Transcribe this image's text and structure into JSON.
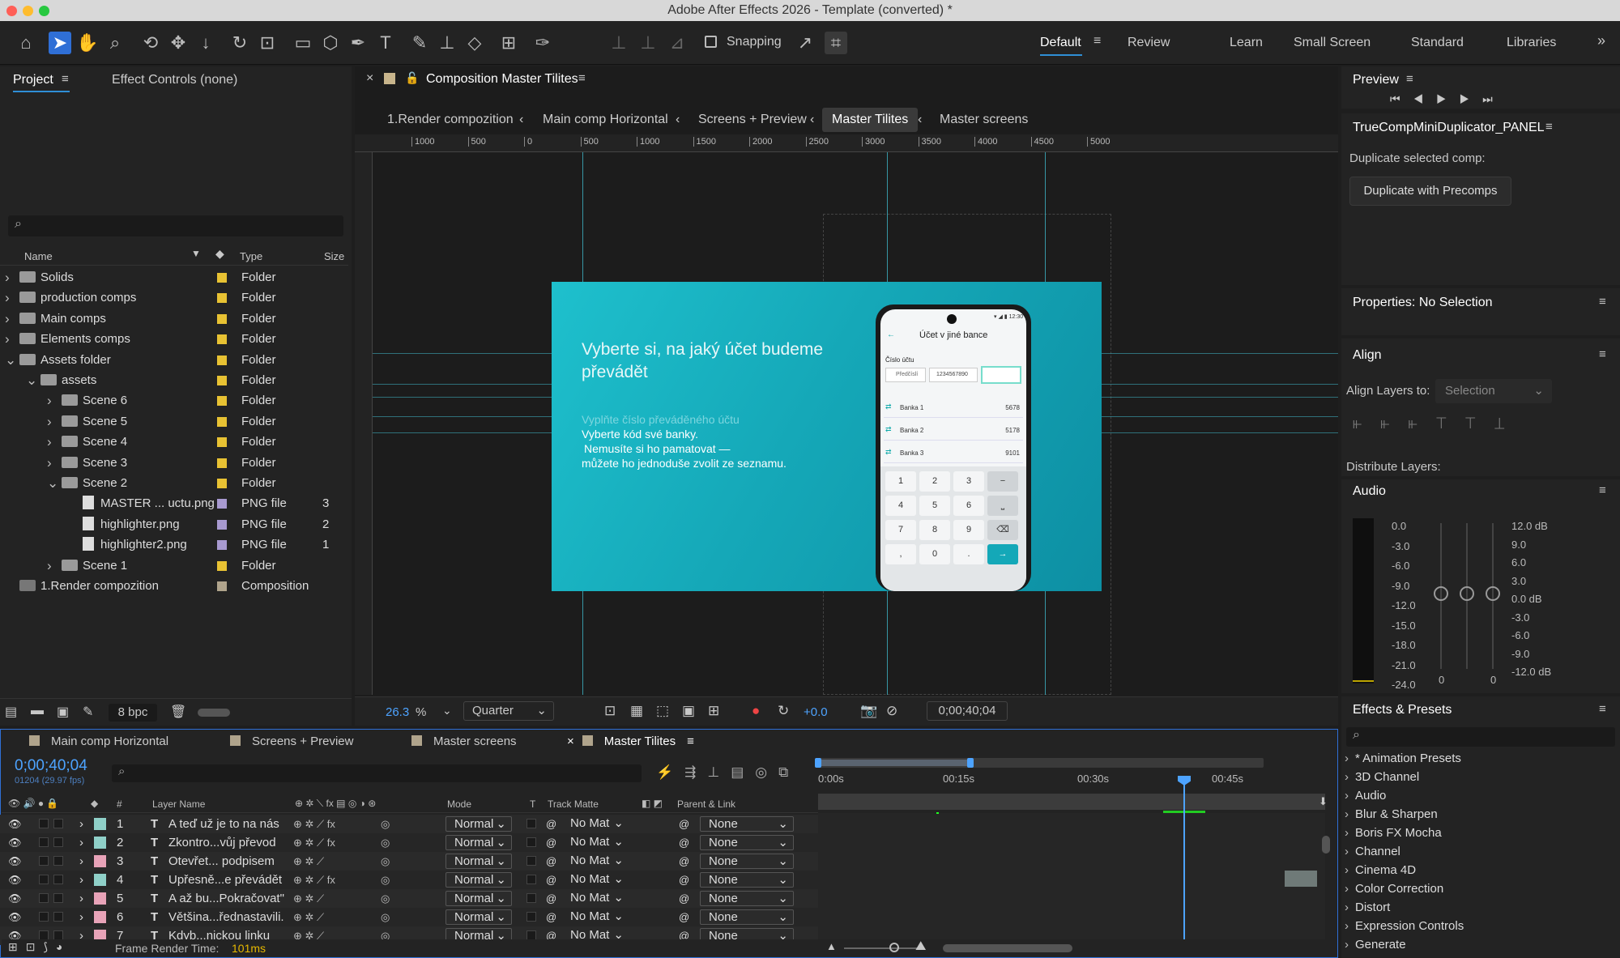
{
  "window": {
    "title": "Adobe After Effects 2026 - Template (converted) *"
  },
  "toolbar": {
    "snapping": "Snapping",
    "workspaces": [
      "Default",
      "Review",
      "Learn",
      "Small Screen",
      "Standard",
      "Libraries"
    ]
  },
  "project": {
    "tab": "Project",
    "effect_controls": "Effect Controls (none)",
    "columns": {
      "name": "Name",
      "type": "Type",
      "size": "Size"
    },
    "items": [
      {
        "name": "Solids",
        "type": "Folder",
        "size": "",
        "color": "#e8c233"
      },
      {
        "name": "production comps",
        "type": "Folder",
        "size": "",
        "color": "#e8c233"
      },
      {
        "name": "Main comps",
        "type": "Folder",
        "size": "",
        "color": "#e8c233"
      },
      {
        "name": "Elements comps",
        "type": "Folder",
        "size": "",
        "color": "#e8c233"
      },
      {
        "name": "Assets folder",
        "type": "Folder",
        "size": "",
        "color": "#e8c233"
      },
      {
        "name": "assets",
        "type": "Folder",
        "size": "",
        "color": "#e8c233"
      },
      {
        "name": "Scene 6",
        "type": "Folder",
        "size": "",
        "color": "#e8c233"
      },
      {
        "name": "Scene 5",
        "type": "Folder",
        "size": "",
        "color": "#e8c233"
      },
      {
        "name": "Scene 4",
        "type": "Folder",
        "size": "",
        "color": "#e8c233"
      },
      {
        "name": "Scene 3",
        "type": "Folder",
        "size": "",
        "color": "#e8c233"
      },
      {
        "name": "Scene 2",
        "type": "Folder",
        "size": "",
        "color": "#e8c233"
      },
      {
        "name": "MASTER ... uctu.png",
        "type": "PNG file",
        "size": "3",
        "color": "#a89ad0"
      },
      {
        "name": "highlighter.png",
        "type": "PNG file",
        "size": "2",
        "color": "#a89ad0"
      },
      {
        "name": "highlighter2.png",
        "type": "PNG file",
        "size": "1",
        "color": "#a89ad0"
      },
      {
        "name": "Scene 1",
        "type": "Folder",
        "size": "",
        "color": "#e8c233"
      },
      {
        "name": "1.Render compozition",
        "type": "Composition",
        "size": "",
        "color": "#b0a48c"
      }
    ],
    "bpc": "8 bpc"
  },
  "composition": {
    "tab": "Composition Master Tilites",
    "breadcrumbs": [
      "1.Render compozition",
      "Main comp Horizontal",
      "Screens + Preview",
      "Master Tilites",
      "Master screens"
    ],
    "ruler": [
      "1000",
      "500",
      "0",
      "500",
      "1000",
      "1500",
      "2000",
      "2500",
      "3000",
      "3500",
      "4000",
      "4500",
      "5000"
    ],
    "zoom": "26.3",
    "zoom_unit": "%",
    "resolution": "Quarter",
    "exposure": "+0.0",
    "timecode": "0;00;40;04"
  },
  "slide": {
    "headline": "Vyberte si, na jaký účet budeme převádět",
    "faded": "Vyplňte číslo převáděného účtu",
    "lines": [
      "Vyberte kód své banky.",
      "Nemusíte si ho pamatovat —",
      "můžete ho jednoduše zvolit ze seznamu."
    ],
    "phone": {
      "title": "Účet v jiné bance",
      "label": "Číslo účtu",
      "prefix": "Předčíslí",
      "account": "1234567890",
      "banks": [
        {
          "name": "Banka 1",
          "code": "5678"
        },
        {
          "name": "Banka 2",
          "code": "5178"
        },
        {
          "name": "Banka 3",
          "code": "9101"
        }
      ],
      "keys": [
        "1",
        "2",
        "3",
        "−",
        "4",
        "5",
        "6",
        "⎵",
        "7",
        "8",
        "9",
        "⌫",
        ",",
        "0",
        ".",
        "→"
      ]
    }
  },
  "right": {
    "preview": "Preview",
    "duplicator": "TrueCompMiniDuplicator_PANEL",
    "dup_label": "Duplicate selected comp:",
    "dup_button": "Duplicate with Precomps",
    "properties": "Properties: No Selection",
    "align": "Align",
    "align_to_label": "Align Layers to:",
    "align_to_value": "Selection",
    "distribute": "Distribute Layers:",
    "audio": "Audio",
    "audio_left": [
      "0.0",
      "-3.0",
      "-6.0",
      "-9.0",
      "-12.0",
      "-15.0",
      "-18.0",
      "-21.0",
      "-24.0"
    ],
    "audio_right": [
      "12.0 dB",
      "9.0",
      "6.0",
      "3.0",
      "0.0 dB",
      "-3.0",
      "-6.0",
      "-9.0",
      "-12.0 dB"
    ],
    "audio_zero_a": "0",
    "audio_zero_b": "0",
    "effects": "Effects & Presets",
    "effects_list": [
      "* Animation Presets",
      "3D Channel",
      "Audio",
      "Blur & Sharpen",
      "Boris FX Mocha",
      "Channel",
      "Cinema 4D",
      "Color Correction",
      "Distort",
      "Expression Controls",
      "Generate"
    ]
  },
  "timeline": {
    "tabs": [
      "Main comp Horizontal",
      "Screens + Preview",
      "Master screens",
      "Master Tilites"
    ],
    "timecode": "0;00;40;04",
    "frames": "01204 (29.97 fps)",
    "columns": {
      "num": "#",
      "layer": "Layer Name",
      "mode": "Mode",
      "t": "T",
      "matte": "Track Matte",
      "parent": "Parent & Link"
    },
    "ruler": [
      "0:00s",
      "00:15s",
      "00:30s",
      "00:45s"
    ],
    "layers": [
      {
        "num": "1",
        "name": "A teď už je to na nás",
        "mode": "Normal",
        "matte": "No Mat",
        "parent": "None",
        "color": "#8fd0c8",
        "fx": true
      },
      {
        "num": "2",
        "name": "Zkontro...vůj převod",
        "mode": "Normal",
        "matte": "No Mat",
        "parent": "None",
        "color": "#8fd0c8",
        "fx": true
      },
      {
        "num": "3",
        "name": "Otevřet... podpisem",
        "mode": "Normal",
        "matte": "No Mat",
        "parent": "None",
        "color": "#e8a3b8",
        "fx": false
      },
      {
        "num": "4",
        "name": "Upřesně...e převádět",
        "mode": "Normal",
        "matte": "No Mat",
        "parent": "None",
        "color": "#8fd0c8",
        "fx": true
      },
      {
        "num": "5",
        "name": "A až bu...Pokračovat\"",
        "mode": "Normal",
        "matte": "No Mat",
        "parent": "None",
        "color": "#e8a3b8",
        "fx": false
      },
      {
        "num": "6",
        "name": "Většina...řednastavili.",
        "mode": "Normal",
        "matte": "No Mat",
        "parent": "None",
        "color": "#e8a3b8",
        "fx": false
      },
      {
        "num": "7",
        "name": "Kdyb...nickou linku",
        "mode": "Normal",
        "matte": "No Mat",
        "parent": "None",
        "color": "#e8a3b8",
        "fx": false
      }
    ],
    "frame_render_label": "Frame Render Time:",
    "frame_render_value": "101ms"
  }
}
